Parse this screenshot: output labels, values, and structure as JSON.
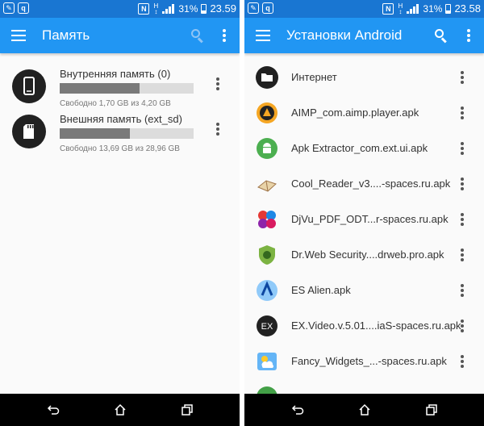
{
  "colors": {
    "status_bar": "#1976d2",
    "app_bar": "#2196f3",
    "nav_bar": "#000000",
    "text_primary": "#333333",
    "text_secondary": "#777777"
  },
  "left_screen": {
    "status_bar": {
      "battery": "31%",
      "time": "23.59",
      "network": "H"
    },
    "app_bar": {
      "title": "Память"
    },
    "storage": [
      {
        "name": "Внутренняя память (0)",
        "free_text": "Свободно 1,70 GB из 4,20 GB",
        "used_fraction": 0.595,
        "icon": "phone-icon"
      },
      {
        "name": "Внешняя память (ext_sd)",
        "free_text": "Свободно 13,69 GB из 28,96 GB",
        "used_fraction": 0.527,
        "icon": "sd-card-icon"
      }
    ]
  },
  "right_screen": {
    "status_bar": {
      "battery": "31%",
      "time": "23.58",
      "network": "H"
    },
    "app_bar": {
      "title": "Установки Android"
    },
    "files": [
      {
        "label": "Интернет",
        "icon": "folder-icon"
      },
      {
        "label": "AIMP_com.aimp.player.apk",
        "icon": "aimp-icon"
      },
      {
        "label": "Apk Extractor_com.ext.ui.apk",
        "icon": "android-icon"
      },
      {
        "label": "Cool_Reader_v3....-spaces.ru.apk",
        "icon": "book-icon"
      },
      {
        "label": "DjVu_PDF_ODT...r-spaces.ru.apk",
        "icon": "djvu-icon"
      },
      {
        "label": "Dr.Web Security....drweb.pro.apk",
        "icon": "drweb-icon"
      },
      {
        "label": "ES Alien.apk",
        "icon": "alien-icon"
      },
      {
        "label": "EX.Video.v.5.01....iaS-spaces.ru.apk",
        "icon": "ex-video-icon"
      },
      {
        "label": "Fancy_Widgets_...-spaces.ru.apk",
        "icon": "weather-widget-icon"
      }
    ]
  }
}
